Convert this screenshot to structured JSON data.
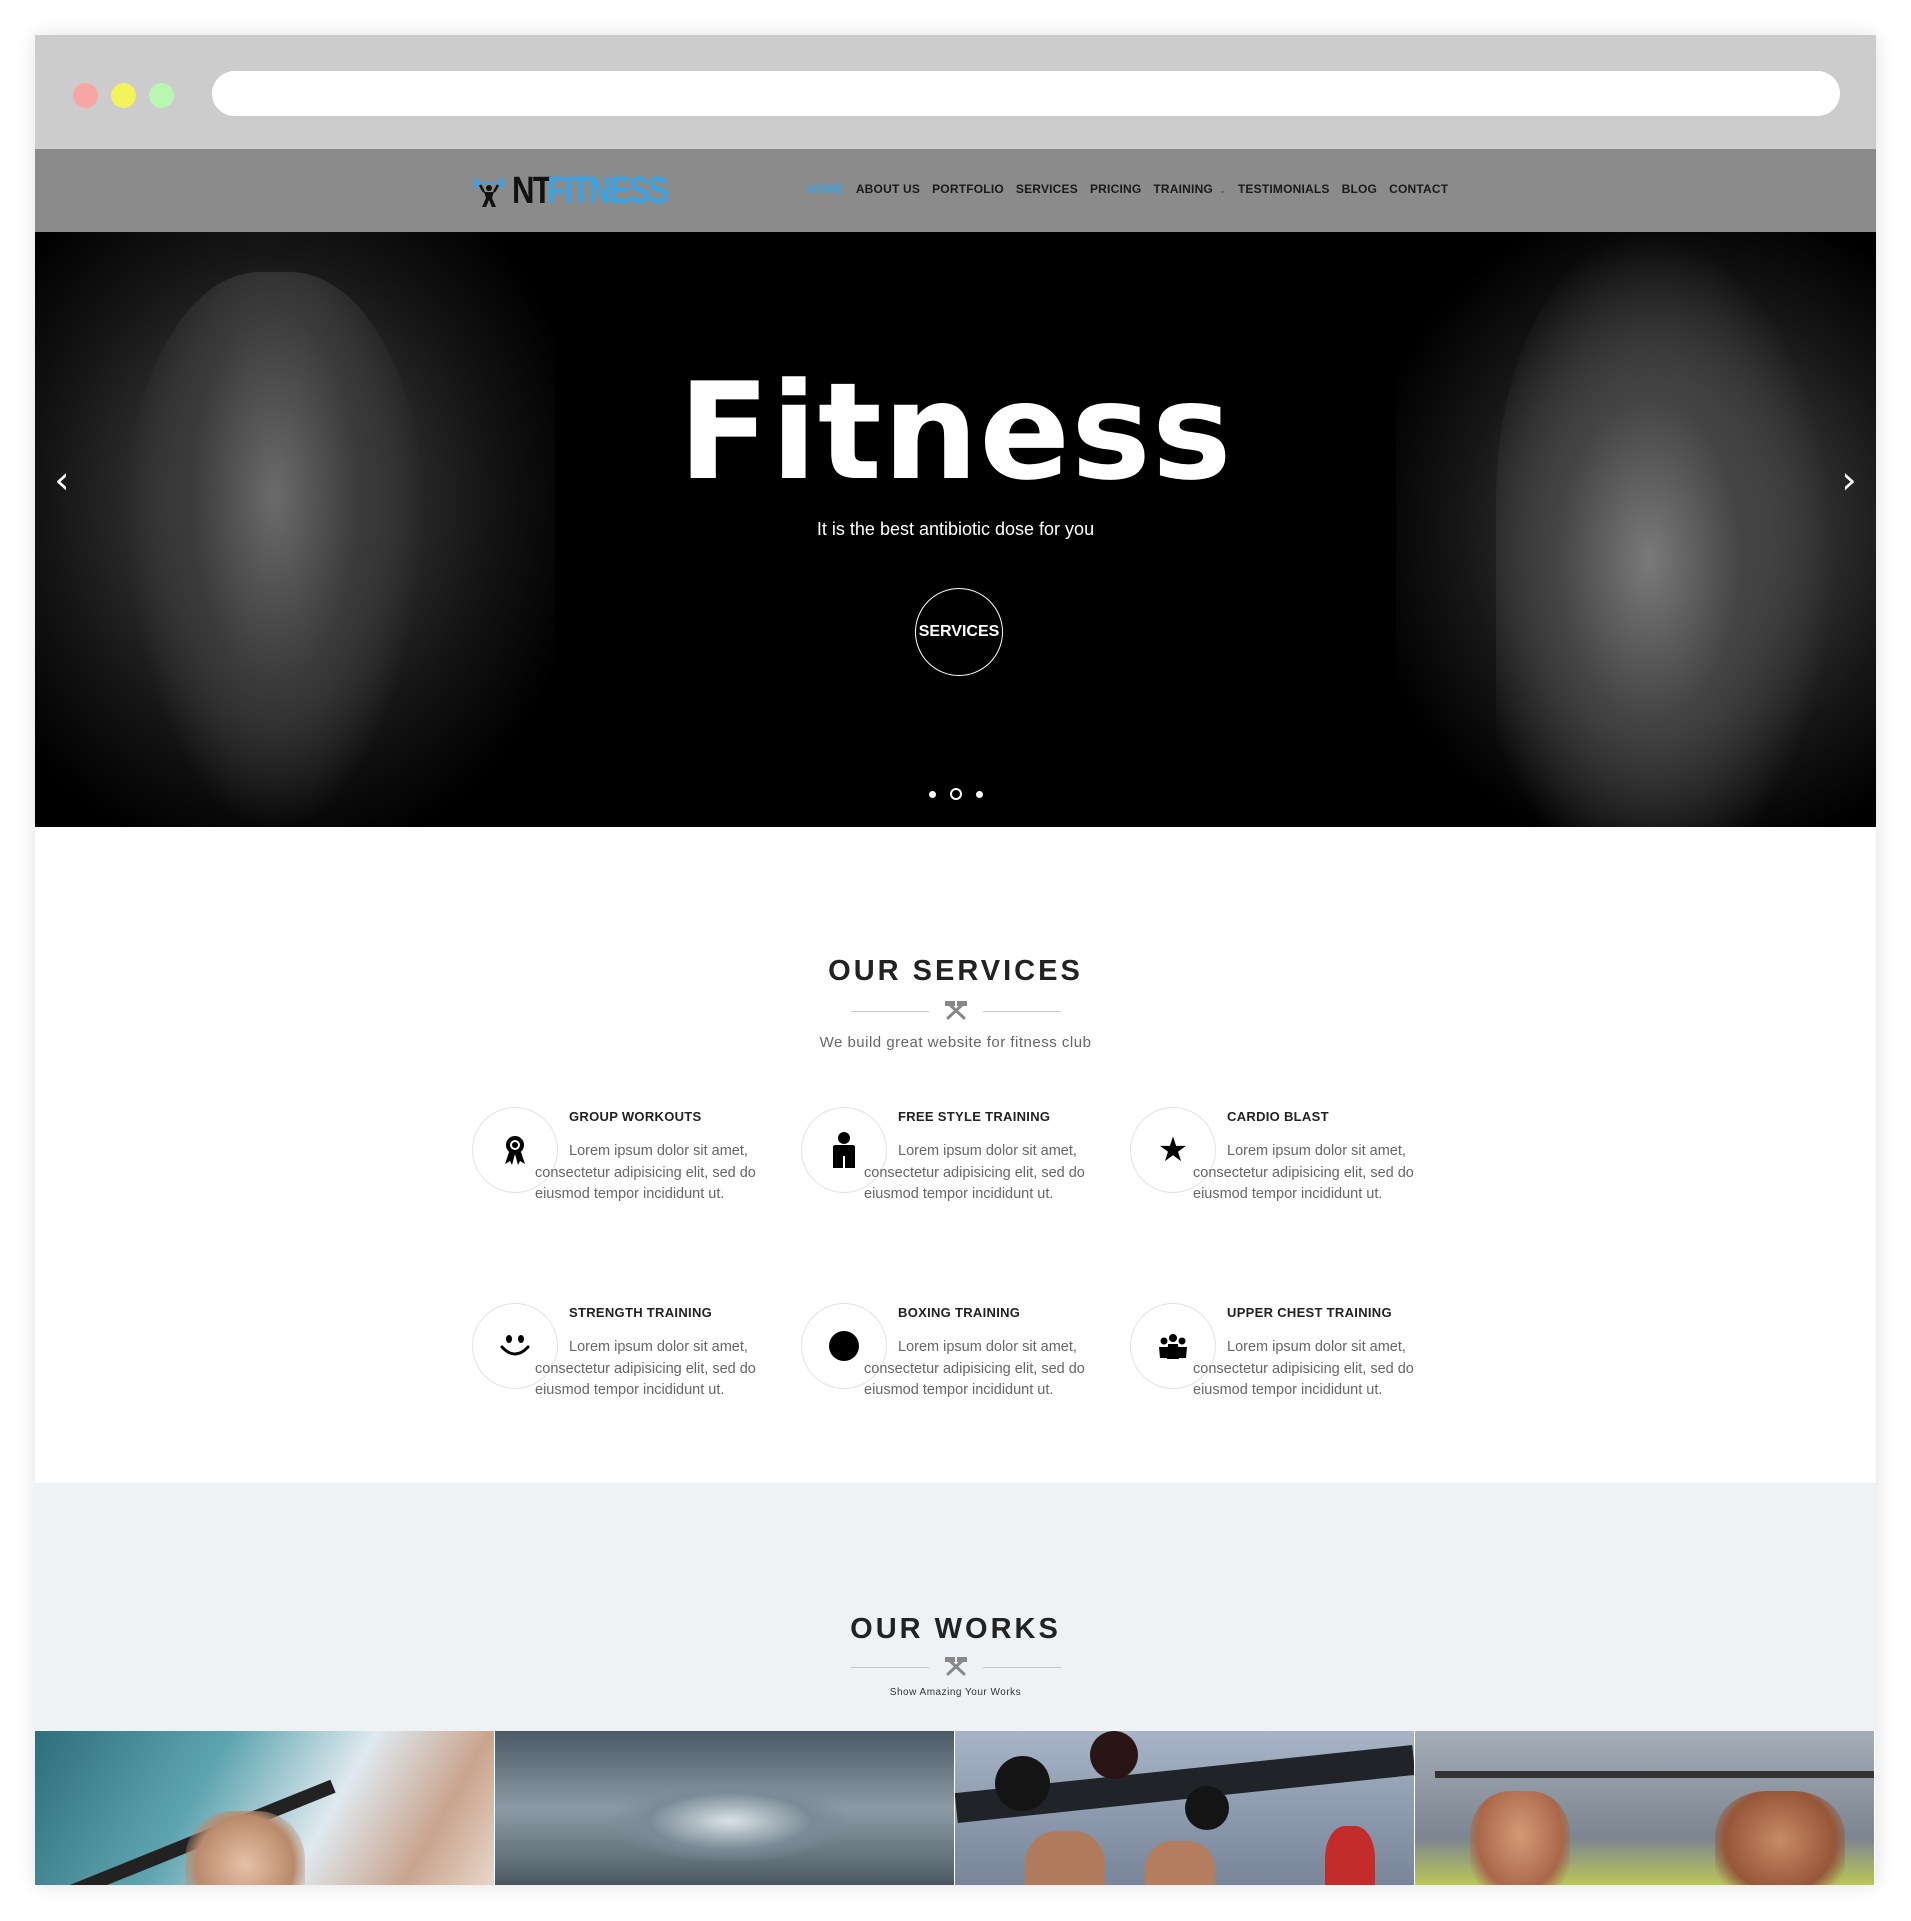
{
  "header": {
    "logo_nt": "NT",
    "logo_fitness": "FITNESS",
    "nav": [
      {
        "label": "HOME",
        "active": true
      },
      {
        "label": "ABOUT US",
        "active": false
      },
      {
        "label": "PORTFOLIO",
        "active": false
      },
      {
        "label": "SERVICES",
        "active": false
      },
      {
        "label": "PRICING",
        "active": false
      },
      {
        "label": "TRAINING",
        "active": false,
        "has_caret": true
      },
      {
        "label": "TESTIMONIALS",
        "active": false
      },
      {
        "label": "BLOG",
        "active": false
      },
      {
        "label": "CONTACT",
        "active": false
      }
    ],
    "accent_color": "#3aa3e3"
  },
  "hero": {
    "title": "Fitness",
    "subtitle": "It is the best antibiotic dose for you",
    "button_label": "SERVICES",
    "prev_icon": "chevron-left-icon",
    "next_icon": "chevron-right-icon",
    "slide_count": 3,
    "active_slide": 2
  },
  "services": {
    "title": "OUR SERVICES",
    "subtitle": "We build great website for fitness club",
    "items": [
      {
        "title": "GROUP WORKOUTS",
        "icon": "award-icon",
        "body": "Lorem ipsum dolor sit amet, consectetur adipisicing elit, sed do eiusmod tempor incididunt ut."
      },
      {
        "title": "FREE STYLE TRAINING",
        "icon": "person-icon",
        "body": "Lorem ipsum dolor sit amet, consectetur adipisicing elit, sed do eiusmod tempor incididunt ut."
      },
      {
        "title": "CARDIO BLAST",
        "icon": "star-icon",
        "body": "Lorem ipsum dolor sit amet, consectetur adipisicing elit, sed do eiusmod tempor incididunt ut."
      },
      {
        "title": "STRENGTH TRAINING",
        "icon": "smile-icon",
        "body": "Lorem ipsum dolor sit amet, consectetur adipisicing elit, sed do eiusmod tempor incididunt ut."
      },
      {
        "title": "BOXING TRAINING",
        "icon": "circle-icon",
        "body": "Lorem ipsum dolor sit amet, consectetur adipisicing elit, sed do eiusmod tempor incididunt ut."
      },
      {
        "title": "UPPER CHEST TRAINING",
        "icon": "group-icon",
        "body": "Lorem ipsum dolor sit amet, consectetur adipisicing elit, sed do eiusmod tempor incididunt ut."
      }
    ]
  },
  "works": {
    "title": "OUR WORKS",
    "subtitle": "Show Amazing Your Works",
    "tiles": [
      "gym-pullup-woman",
      "swimmer-underwater",
      "medicine-ball-wall",
      "pullup-men"
    ]
  }
}
